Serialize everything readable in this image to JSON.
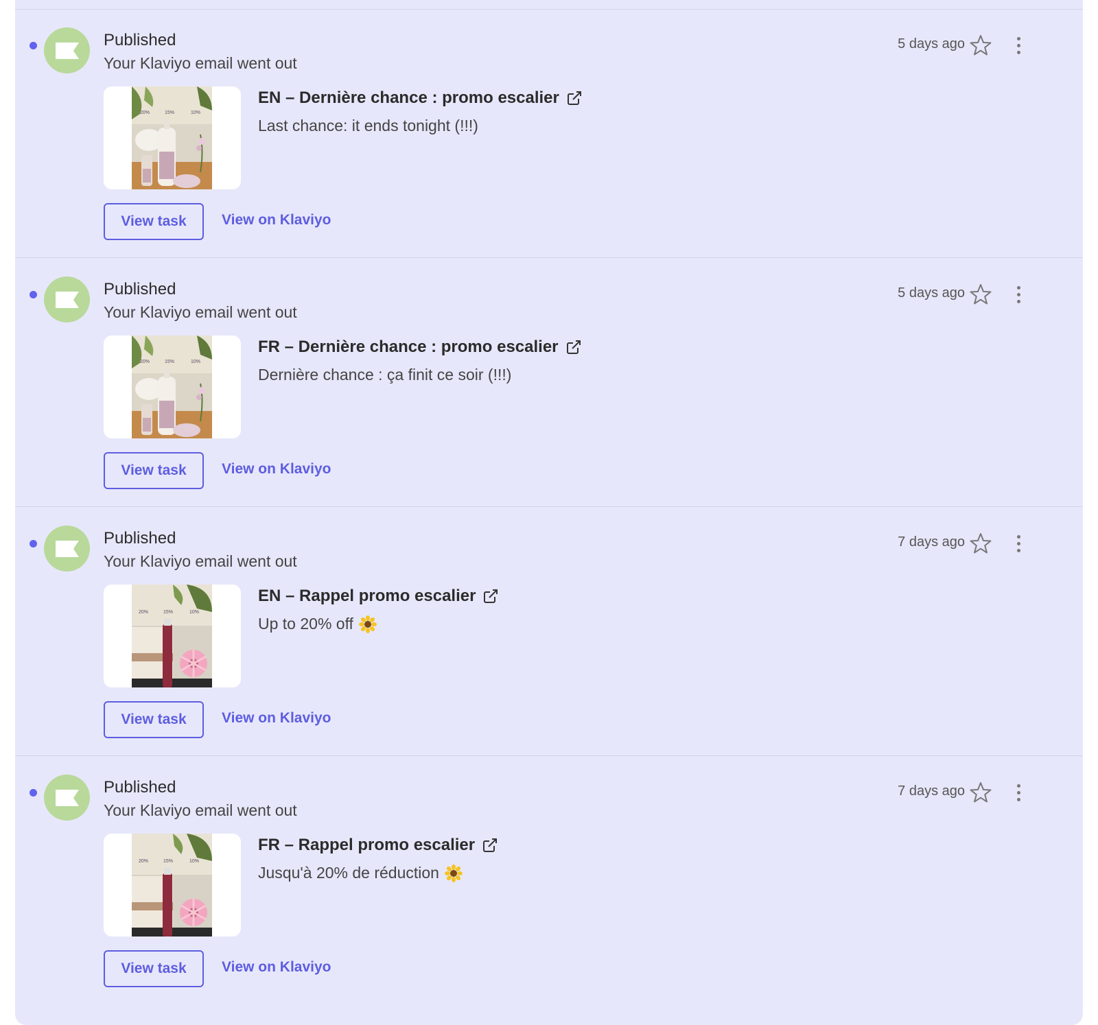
{
  "colors": {
    "feed_background": "#e7e7fb",
    "accent": "#5d5de0",
    "unread_dot": "#6262ee",
    "avatar": "#b8d99a"
  },
  "items": [
    {
      "status": "Published",
      "subtitle": "Your Klaviyo email went out",
      "timestamp": "5 days ago",
      "email_title": "EN – Dernière chance : promo escalier",
      "email_preview": "Last chance: it ends tonight (!!!)",
      "preview_emoji": "",
      "view_task_label": "View task",
      "view_klaviyo_label": "View on Klaviyo",
      "thumbnail": "product-bottles",
      "unread": true,
      "starred": false
    },
    {
      "status": "Published",
      "subtitle": "Your Klaviyo email went out",
      "timestamp": "5 days ago",
      "email_title": "FR – Dernière chance : promo escalier",
      "email_preview": "Dernière chance : ça finit ce soir (!!!)",
      "preview_emoji": "",
      "view_task_label": "View task",
      "view_klaviyo_label": "View on Klaviyo",
      "thumbnail": "product-bottles",
      "unread": true,
      "starred": false
    },
    {
      "status": "Published",
      "subtitle": "Your Klaviyo email went out",
      "timestamp": "7 days ago",
      "email_title": "EN – Rappel promo escalier",
      "email_preview": "Up to 20% off",
      "preview_emoji": "sunflower-icon",
      "view_task_label": "View task",
      "view_klaviyo_label": "View on Klaviyo",
      "thumbnail": "product-tube-flower",
      "unread": true,
      "starred": false
    },
    {
      "status": "Published",
      "subtitle": "Your Klaviyo email went out",
      "timestamp": "7 days ago",
      "email_title": "FR – Rappel promo escalier",
      "email_preview": "Jusqu'à 20% de réduction",
      "preview_emoji": "sunflower-icon",
      "view_task_label": "View task",
      "view_klaviyo_label": "View on Klaviyo",
      "thumbnail": "product-tube-flower",
      "unread": true,
      "starred": false
    }
  ]
}
